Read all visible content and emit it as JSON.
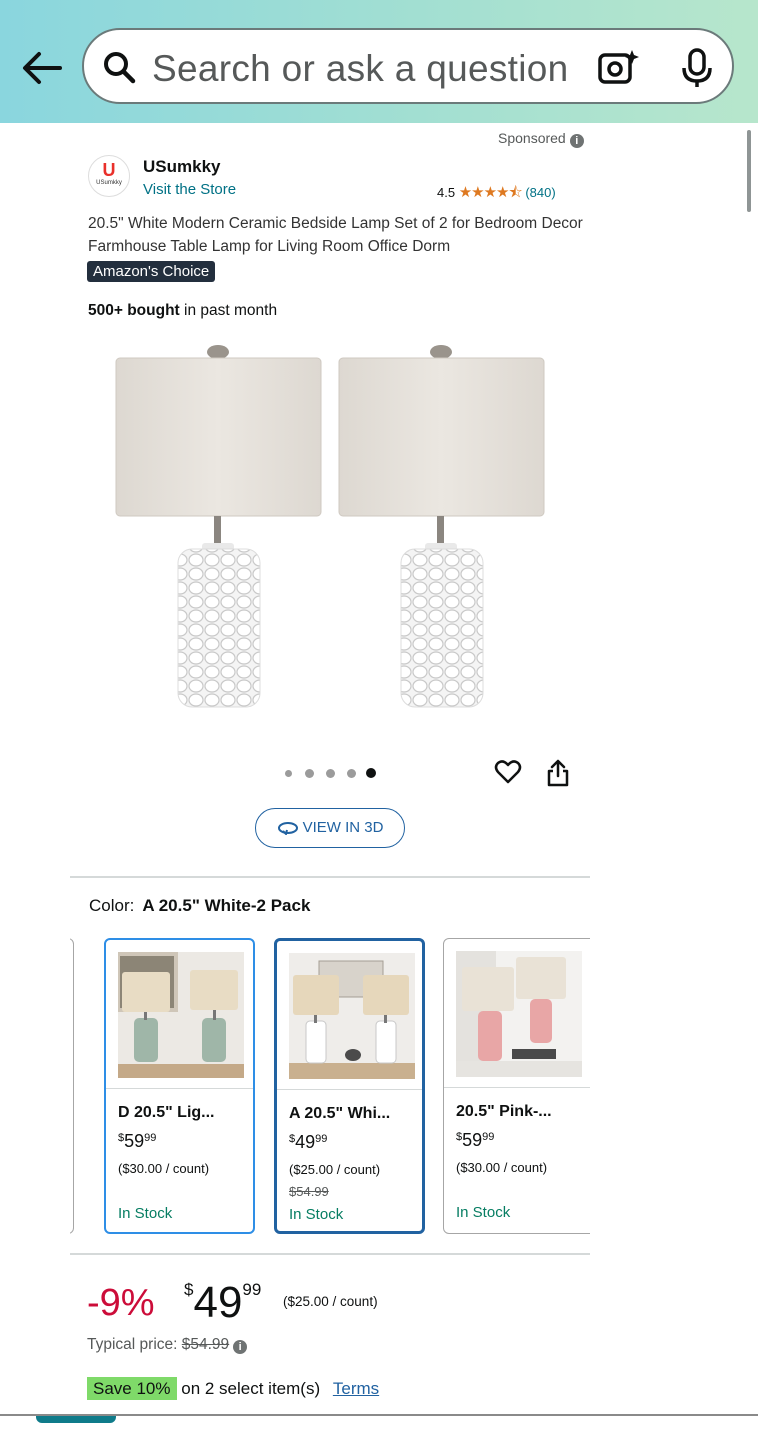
{
  "search": {
    "placeholder": "Search or ask a question"
  },
  "sponsored_label": "Sponsored",
  "brand": {
    "logo_letter": "U",
    "logo_text": "USumkky",
    "name": "USumkky",
    "visit_link": "Visit the Store"
  },
  "rating": {
    "value": "4.5",
    "stars": "★★★★⯪",
    "count": "(840)"
  },
  "product": {
    "title": "20.5\" White Modern Ceramic Bedside Lamp Set of 2 for Bedroom Decor Farmhouse Table Lamp for Living Room Office Dorm",
    "badge": "Amazon's Choice",
    "bought_bold": "500+ bought",
    "bought_rest": " in past month"
  },
  "gallery": {
    "image_count": 5,
    "selected_index": 4
  },
  "view3d_label": "VIEW IN 3D",
  "color": {
    "label": "Color:",
    "selected": "A 20.5\" White-2 Pack"
  },
  "variants": [
    {
      "name": "D 20.5\" Lig...",
      "price_whole": "59",
      "price_cents": "99",
      "currency": "$",
      "unit": "($30.00 / count)",
      "list_price": "",
      "stock": "In Stock"
    },
    {
      "name": "A 20.5\" Whi...",
      "price_whole": "49",
      "price_cents": "99",
      "currency": "$",
      "unit": "($25.00 / count)",
      "list_price": "$54.99",
      "stock": "In Stock"
    },
    {
      "name": "20.5\" Pink-...",
      "price_whole": "59",
      "price_cents": "99",
      "currency": "$",
      "unit": "($30.00 / count)",
      "list_price": "",
      "stock": "In Stock"
    }
  ],
  "price": {
    "discount": "-9%",
    "currency": "$",
    "whole": "49",
    "cents": "99",
    "per_unit": "($25.00 / count)",
    "typical_label": "Typical price:",
    "typical_value": "$54.99"
  },
  "promo": {
    "badge": "Save 10%",
    "text": "on 2 select item(s)",
    "terms": "Terms"
  },
  "colors": {
    "deal_red": "#cc0c39",
    "link_blue": "#007185",
    "stock_green": "#067d62",
    "star_orange": "#de7921",
    "save_green": "#7fda69"
  }
}
